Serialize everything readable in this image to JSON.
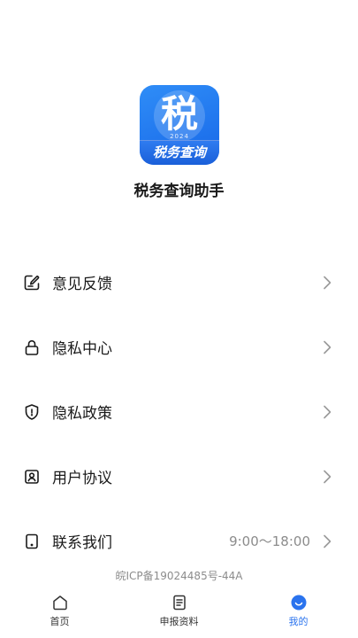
{
  "app": {
    "logo_char": "税",
    "logo_year": "2024",
    "logo_label": "税务查询",
    "name": "税务查询助手"
  },
  "menu": {
    "items": [
      {
        "label": "意见反馈",
        "icon": "feedback-icon"
      },
      {
        "label": "隐私中心",
        "icon": "lock-icon"
      },
      {
        "label": "隐私政策",
        "icon": "shield-icon"
      },
      {
        "label": "用户协议",
        "icon": "user-agreement-icon"
      },
      {
        "label": "联系我们",
        "icon": "phone-icon",
        "value": "9:00～18:00"
      }
    ]
  },
  "footer": {
    "icp": "皖ICP备19024485号-44A"
  },
  "tabbar": {
    "tabs": [
      {
        "label": "首页",
        "icon": "home-icon",
        "active": false
      },
      {
        "label": "申报资料",
        "icon": "document-icon",
        "active": false
      },
      {
        "label": "我的",
        "icon": "profile-icon",
        "active": true
      }
    ]
  },
  "colors": {
    "accent": "#2a73ee",
    "text": "#1a1a1a",
    "muted": "#8c8c8c"
  }
}
